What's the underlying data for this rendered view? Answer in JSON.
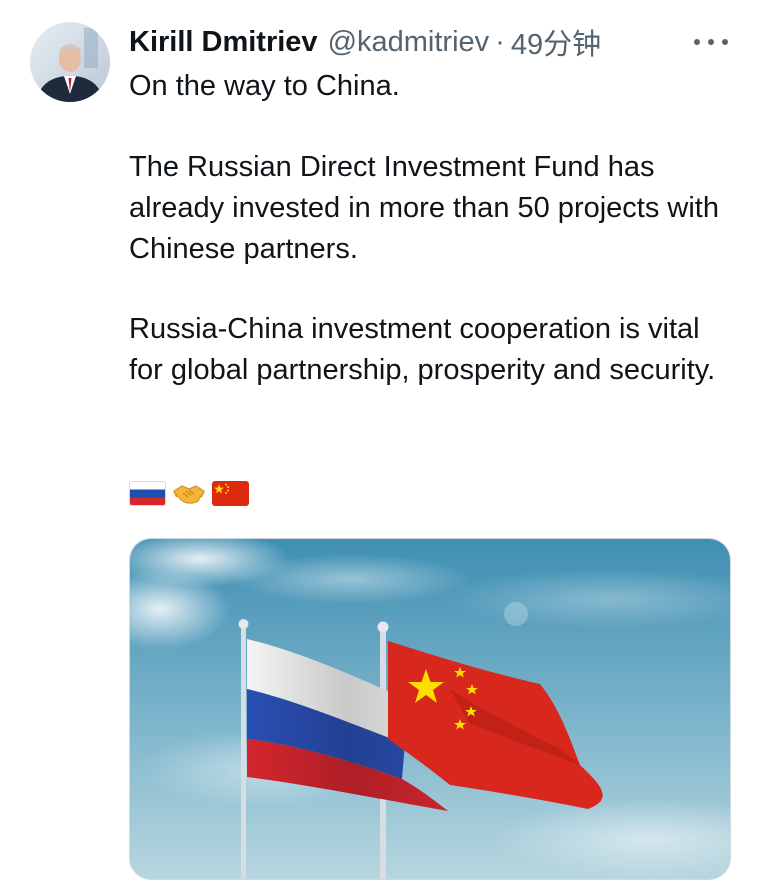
{
  "tweet": {
    "author_name": "Kirill Dmitriev",
    "handle": "@kadmitriev",
    "separator": "·",
    "time": "49分钟",
    "text_line1": "On the way to China.",
    "text_para2": "The Russian Direct Investment Fund has already invested in more than 50 projects with Chinese partners.",
    "text_para3": "Russia-China investment cooperation is vital for global partnership, prosperity and security.",
    "emojis": [
      "russia-flag-icon",
      "handshake-icon",
      "china-flag-icon"
    ]
  },
  "colors": {
    "text_primary": "#0f1419",
    "text_secondary": "#536471",
    "border": "#cfd9de"
  },
  "icons": {
    "more": "more-horizontal-icon"
  }
}
